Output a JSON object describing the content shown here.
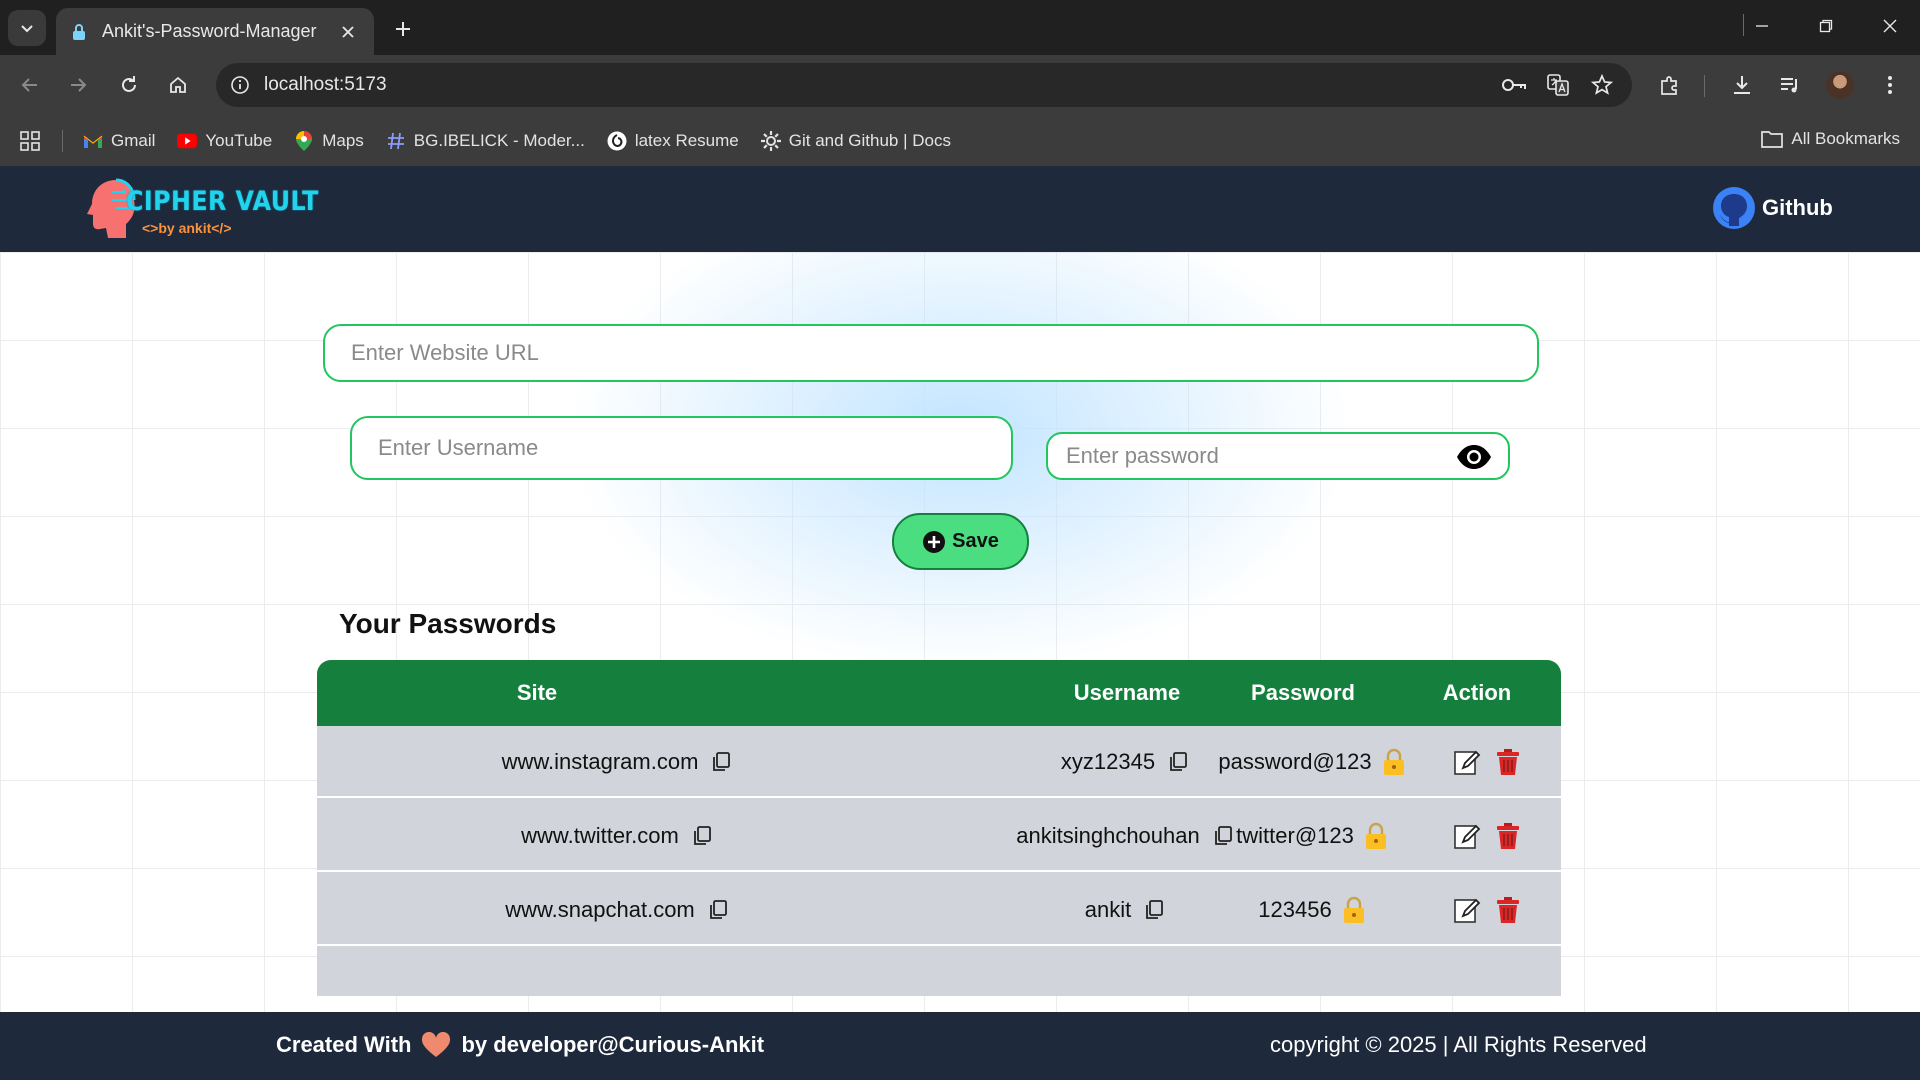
{
  "browser": {
    "tab_title": "Ankit's-Password-Manager",
    "url": "localhost:5173",
    "bookmarks": [
      {
        "label": "Gmail"
      },
      {
        "label": "YouTube"
      },
      {
        "label": "Maps"
      },
      {
        "label": "BG.IBELICK - Moder..."
      },
      {
        "label": "latex Resume"
      },
      {
        "label": "Git and Github | Docs"
      }
    ],
    "all_bookmarks_label": "All Bookmarks"
  },
  "app": {
    "logo_title": "CIPHER VAULT",
    "logo_subtitle": "<>by ankit</>",
    "github_label": "Github",
    "form": {
      "url_placeholder": "Enter Website URL",
      "username_placeholder": "Enter Username",
      "password_placeholder": "Enter password",
      "save_label": "Save"
    },
    "section_title": "Your Passwords",
    "table": {
      "headers": [
        "Site",
        "Username",
        "Password",
        "Action"
      ],
      "rows": [
        {
          "site": "www.instagram.com",
          "username": "xyz12345",
          "password": "password@123"
        },
        {
          "site": "www.twitter.com",
          "username": "ankitsinghchouhan",
          "password": "twitter@123"
        },
        {
          "site": "www.snapchat.com",
          "username": "ankit",
          "password": "123456"
        }
      ]
    },
    "footer": {
      "created_prefix": "Created With",
      "created_suffix": "by developer@Curious-Ankit",
      "copyright": "copyright © 2025 | All Rights Reserved"
    }
  },
  "colors": {
    "nav_bg": "#1e293b",
    "accent_green": "#22c55e",
    "table_header": "#15803d",
    "save_button": "#4ade80",
    "logo_cyan": "#22d3ee",
    "logo_orange": "#fb923c"
  }
}
